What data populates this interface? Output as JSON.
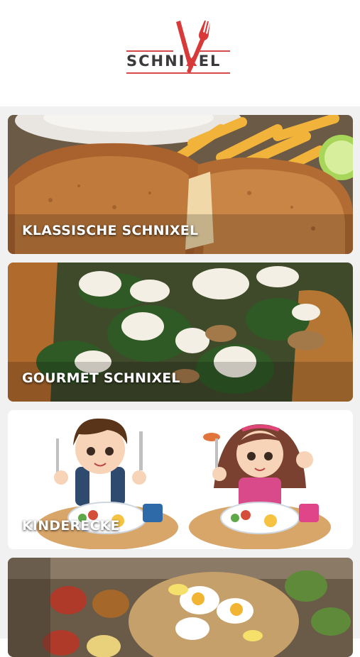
{
  "brand": {
    "logo_text": "SCHNIXEL",
    "logo_left": "SCHNI",
    "logo_x": "X",
    "logo_right": "EL",
    "accent_color": "#d83a3a"
  },
  "categories": [
    {
      "label": "KLASSISCHE SCHNIXEL",
      "image": "schnitzel-fries-photo"
    },
    {
      "label": "GOURMET SCHNIXEL",
      "image": "feta-spinach-schnitzel-photo"
    },
    {
      "label": "KINDERECKE",
      "image": "kids-illustration"
    },
    {
      "label": "",
      "image": "sharing-platter-photo"
    }
  ]
}
